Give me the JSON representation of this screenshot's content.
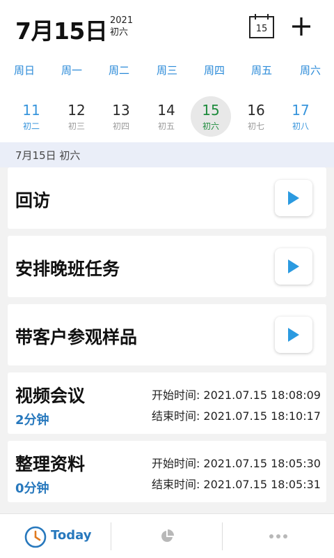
{
  "header": {
    "date": "7月15日",
    "year": "2021",
    "lunar": "初六",
    "calendar_day": "15"
  },
  "weekdays": [
    "周日",
    "周一",
    "周二",
    "周三",
    "周四",
    "周五",
    "周六"
  ],
  "days": [
    {
      "num": "11",
      "lunar": "初二"
    },
    {
      "num": "12",
      "lunar": "初三"
    },
    {
      "num": "13",
      "lunar": "初四"
    },
    {
      "num": "14",
      "lunar": "初五"
    },
    {
      "num": "15",
      "lunar": "初六"
    },
    {
      "num": "16",
      "lunar": "初七"
    },
    {
      "num": "17",
      "lunar": "初八"
    }
  ],
  "section": {
    "label": "7月15日 初六"
  },
  "tasks": [
    {
      "title": "回访"
    },
    {
      "title": "安排晚班任务"
    },
    {
      "title": "带客户参观样品"
    }
  ],
  "records": [
    {
      "title": "视频会议",
      "duration": "2分钟",
      "start": "开始时间: 2021.07.15 18:08:09",
      "end": "结束时间: 2021.07.15 18:10:17"
    },
    {
      "title": "整理资料",
      "duration": "0分钟",
      "start": "开始时间: 2021.07.15 18:05:30",
      "end": "结束时间: 2021.07.15 18:05:31"
    }
  ],
  "tabbar": {
    "today_label": "Today",
    "icons": [
      "clock-icon",
      "pie-chart-icon",
      "more-icon"
    ]
  },
  "colors": {
    "accent_blue": "#2778bd",
    "weekday_blue": "#2a8ad8",
    "selected_green": "#1d8b3c",
    "play_blue": "#2b9ae0"
  }
}
